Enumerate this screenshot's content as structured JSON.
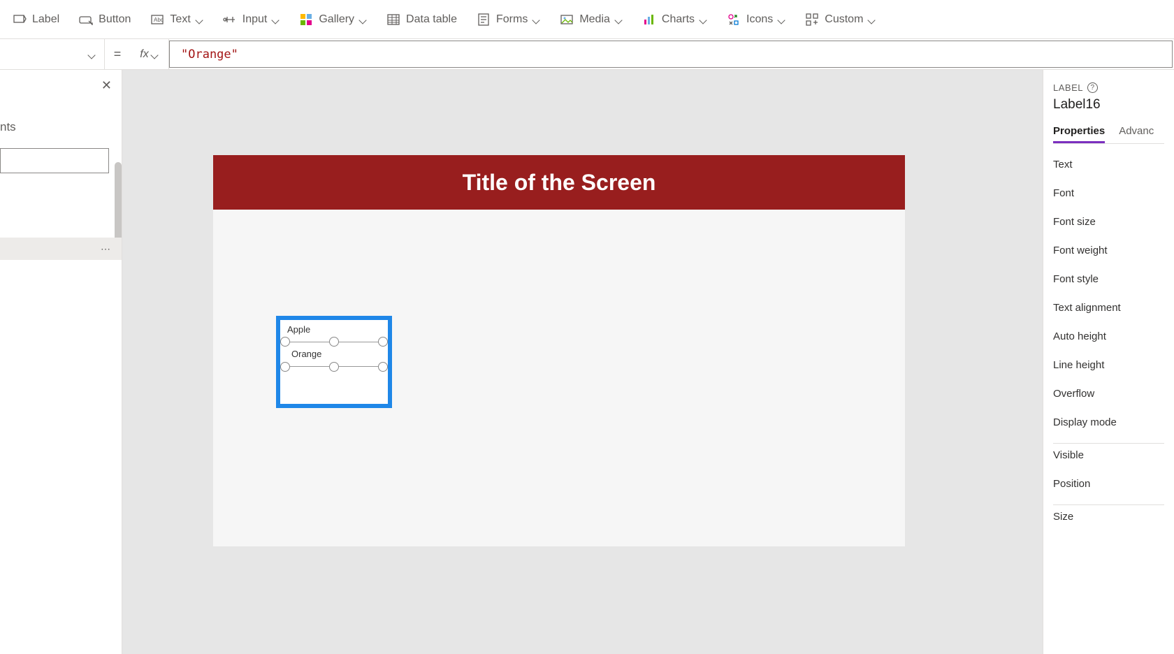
{
  "ribbon": {
    "label": "Label",
    "button": "Button",
    "text": "Text",
    "input": "Input",
    "gallery": "Gallery",
    "datatable": "Data table",
    "forms": "Forms",
    "media": "Media",
    "charts": "Charts",
    "icons": "Icons",
    "custom": "Custom"
  },
  "formula": {
    "equals": "=",
    "fx": "fx",
    "value": "\"Orange\""
  },
  "tree": {
    "subtitle": "nts",
    "more": "⋯"
  },
  "canvas": {
    "title": "Title of the Screen",
    "gallery": {
      "item1": "Apple",
      "item2": "Orange"
    }
  },
  "props": {
    "header": "LABEL",
    "help": "?",
    "name": "Label16",
    "tabs": {
      "properties": "Properties",
      "advanced": "Advanc"
    },
    "rows": {
      "text": "Text",
      "font": "Font",
      "fontsize": "Font size",
      "fontweight": "Font weight",
      "fontstyle": "Font style",
      "textalignment": "Text alignment",
      "autoheight": "Auto height",
      "lineheight": "Line height",
      "overflow": "Overflow",
      "displaymode": "Display mode",
      "visible": "Visible",
      "position": "Position",
      "size": "Size"
    }
  }
}
